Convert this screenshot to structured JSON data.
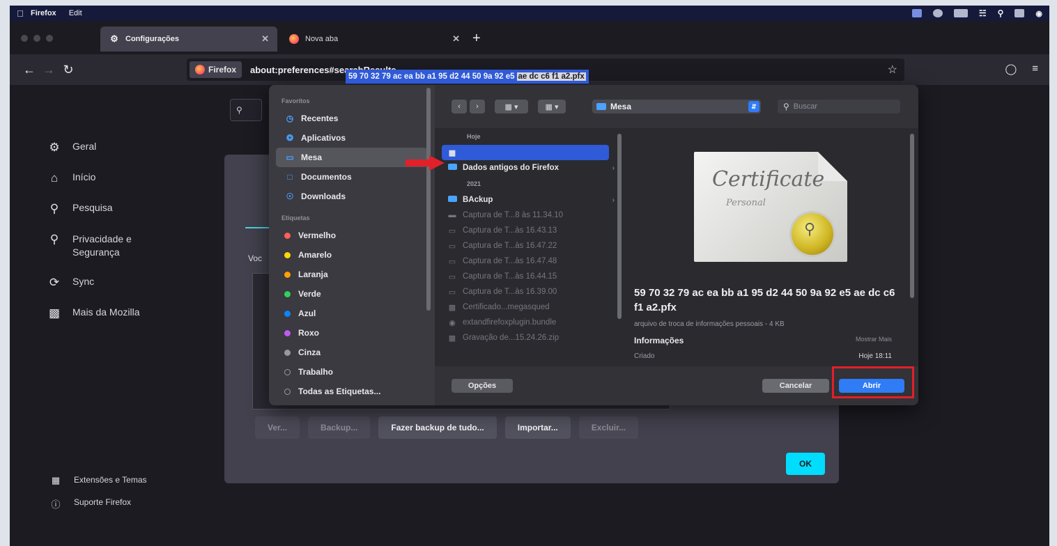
{
  "menubar": {
    "app": "Firefox",
    "menu_edit": "Edit"
  },
  "tabs": [
    {
      "label": "Configurações",
      "icon": "gear-icon"
    },
    {
      "label": "Nova aba",
      "icon": "firefox-icon"
    }
  ],
  "urlbar": {
    "badge": "Firefox",
    "url": "about:preferences#searchResults"
  },
  "prefs_sidebar": {
    "items": [
      {
        "label": "Geral",
        "icon": "gear-icon"
      },
      {
        "label": "Início",
        "icon": "home-icon"
      },
      {
        "label": "Pesquisa",
        "icon": "search-icon"
      },
      {
        "label": "Privacidade e Segurança",
        "icon": "lock-icon"
      },
      {
        "label": "Sync",
        "icon": "sync-icon"
      },
      {
        "label": "Mais da Mozilla",
        "icon": "mozilla-icon"
      }
    ],
    "footer": [
      {
        "label": "Extensões e Temas",
        "icon": "puzzle-icon"
      },
      {
        "label": "Suporte Firefox",
        "icon": "help-icon"
      }
    ]
  },
  "cert_manager": {
    "text_fragment": "Voc",
    "buttons": [
      "Ver...",
      "Backup...",
      "Fazer backup de tudo...",
      "Importar...",
      "Excluir..."
    ],
    "ok": "OK"
  },
  "file_panel": {
    "sidebar": {
      "favorites_header": "Favoritos",
      "favorites": [
        "Recentes",
        "Aplicativos",
        "Mesa",
        "Documentos",
        "Downloads"
      ],
      "selected": "Mesa",
      "tags_header": "Etiquetas",
      "tags": [
        {
          "label": "Vermelho",
          "color": "#ff5f57"
        },
        {
          "label": "Amarelo",
          "color": "#ffd60a"
        },
        {
          "label": "Laranja",
          "color": "#ff9f0a"
        },
        {
          "label": "Verde",
          "color": "#30d158"
        },
        {
          "label": "Azul",
          "color": "#0a84ff"
        },
        {
          "label": "Roxo",
          "color": "#bf5af2"
        },
        {
          "label": "Cinza",
          "color": "#98989d"
        },
        {
          "label": "Trabalho",
          "color": ""
        },
        {
          "label": "Todas as Etiquetas...",
          "color": ""
        }
      ]
    },
    "location": "Mesa",
    "search_placeholder": "Buscar",
    "list": {
      "section_today": "Hoje",
      "selected_file": "59 70 32 79 ac ea bb a1 95 d2 44 50 9a 92 e5",
      "selected_file_tail": "ae dc c6 f1 a2.pfx",
      "folder_today": "Dados antigos do Firefox",
      "section_year": "2021",
      "folder_year": "BAckup",
      "dim_files": [
        "Captura de T...8 às 11.34.10",
        "Captura de T...às 16.43.13",
        "Captura de T...às 16.47.22",
        "Captura de T...às 16.47.48",
        "Captura de T...às 16.44.15",
        "Captura de T...às 16.39.00",
        "Certificado...megasqued",
        "extandfirefoxplugin.bundle",
        "Gravação de...15.24.26.zip"
      ]
    },
    "preview": {
      "cert_title": "Certificate",
      "cert_subtitle": "Personal",
      "filename": "59 70 32 79 ac ea bb a1 95 d2 44 50 9a 92 e5 ae dc c6 f1 a2.pfx",
      "kind": "arquivo de troca de informações pessoais - 4 KB",
      "info_label": "Informações",
      "show_more": "Mostrar Mais",
      "created_label": "Criado",
      "created_value": "Hoje 18:11"
    },
    "footer": {
      "options": "Opções",
      "cancel": "Cancelar",
      "open": "Abrir"
    }
  },
  "colors": {
    "annotation_red": "#e0202a",
    "accent_blue": "#2f7cf6",
    "firefox_cyan": "#00ddff"
  }
}
